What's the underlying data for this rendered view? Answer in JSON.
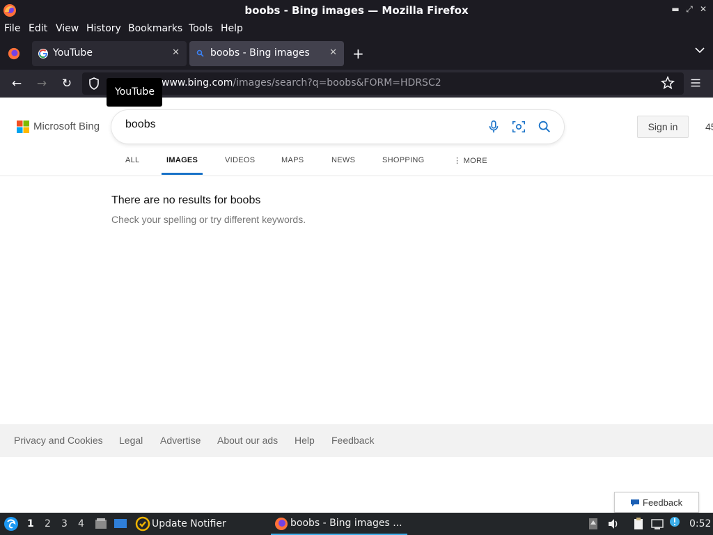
{
  "window": {
    "title": "boobs - Bing images — Mozilla Firefox"
  },
  "menu": {
    "file": "File",
    "edit": "Edit",
    "view": "View",
    "history": "History",
    "bookmarks": "Bookmarks",
    "tools": "Tools",
    "help": "Help"
  },
  "tabs": [
    {
      "label": "YouTube",
      "active": false
    },
    {
      "label": "boobs - Bing images",
      "active": true
    }
  ],
  "navbar": {
    "url_host": "www.bing.com",
    "url_path": "/images/search?q=boobs&FORM=HDRSC2"
  },
  "tooltip": {
    "text": "YouTube"
  },
  "bing": {
    "logo_text": "Microsoft Bing",
    "search_value": "boobs",
    "sign_in": "Sign in",
    "rewards_points": "45",
    "scopes": [
      "ALL",
      "IMAGES",
      "VIDEOS",
      "MAPS",
      "NEWS",
      "SHOPPING",
      "MORE"
    ],
    "active_scope": "IMAGES",
    "no_results_title": "There are no results for boobs",
    "no_results_sub": "Check your spelling or try different keywords.",
    "footer_links": [
      "Privacy and Cookies",
      "Legal",
      "Advertise",
      "About our ads",
      "Help",
      "Feedback"
    ],
    "feedback_button": "Feedback"
  },
  "taskbar": {
    "workspaces": [
      "1",
      "2",
      "3",
      "4"
    ],
    "notifier": "Update Notifier",
    "active_window": "boobs - Bing images ...",
    "clock": "0:52"
  },
  "colors": {
    "chrome_dark": "#1c1b22",
    "toolbar": "#2b2a33",
    "bing_blue": "#1a73c8",
    "taskbar": "#232629"
  }
}
